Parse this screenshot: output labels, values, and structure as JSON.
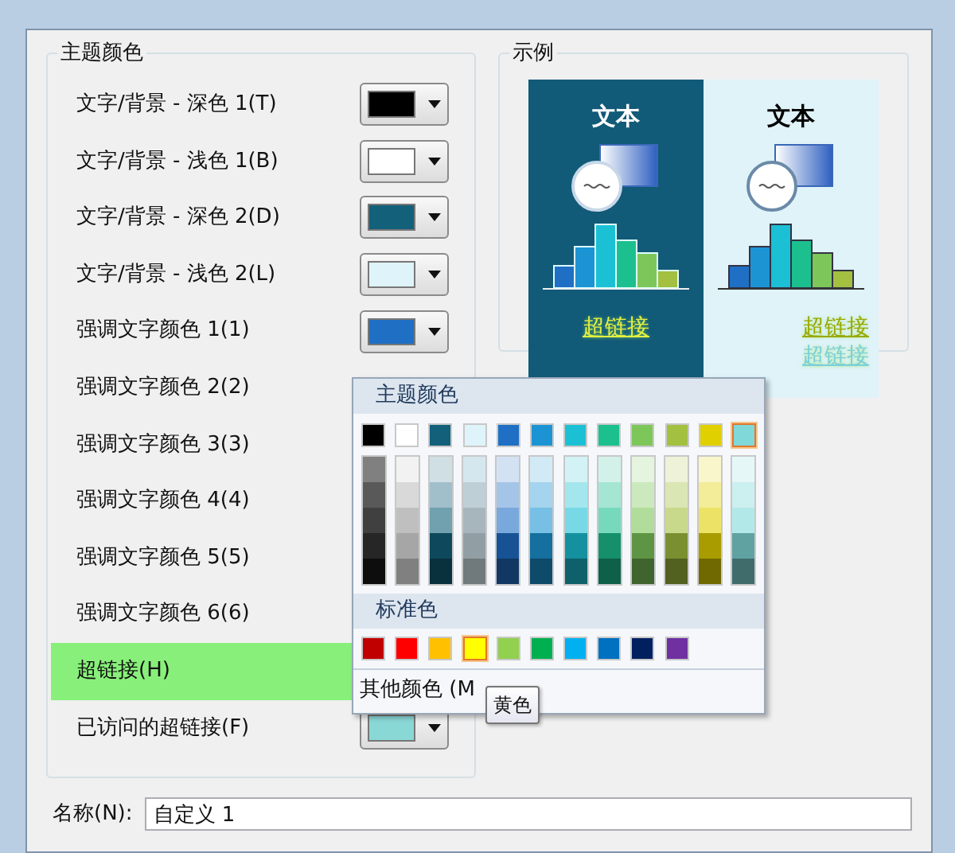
{
  "theme_colors": {
    "title": "主题颜色",
    "items": [
      {
        "label": "文字/背景 - 深色 1(T)",
        "color": "#000000",
        "highlighted": false
      },
      {
        "label": "文字/背景 - 浅色 1(B)",
        "color": "#ffffff",
        "highlighted": false
      },
      {
        "label": "文字/背景 - 深色 2(D)",
        "color": "#12607a",
        "highlighted": false
      },
      {
        "label": "文字/背景 - 浅色 2(L)",
        "color": "#dff3fa",
        "highlighted": false
      },
      {
        "label": "强调文字颜色 1(1)",
        "color": "#1f6fc5",
        "highlighted": false
      },
      {
        "label": "强调文字颜色 2(2)",
        "highlighted": false
      },
      {
        "label": "强调文字颜色 3(3)",
        "highlighted": false
      },
      {
        "label": "强调文字颜色 4(4)",
        "highlighted": false
      },
      {
        "label": "强调文字颜色 5(5)",
        "highlighted": false
      },
      {
        "label": "强调文字颜色 6(6)",
        "highlighted": false
      },
      {
        "label": "超链接(H)",
        "highlighted": true
      },
      {
        "label": "已访问的超链接(F)",
        "color": "#8ad8d6",
        "highlighted": false
      }
    ]
  },
  "sample": {
    "title": "示例",
    "panels": [
      {
        "kind": "dark",
        "color": "#115a78",
        "heading": "文本",
        "links": [
          {
            "text": "超链接",
            "color": "#e4f040"
          }
        ]
      },
      {
        "kind": "light",
        "color": "#dff3f9",
        "heading": "文本",
        "links": [
          {
            "text": "超链接",
            "color": "#9aa800"
          },
          {
            "text": "超链接",
            "color": "#7ccfd8"
          }
        ]
      }
    ]
  },
  "color_menu": {
    "theme_title": "主题颜色",
    "theme_swatches": [
      {
        "color": "#000000",
        "selected": false
      },
      {
        "color": "#ffffff",
        "selected": false
      },
      {
        "color": "#12607a",
        "selected": false
      },
      {
        "color": "#dff3fa",
        "selected": false
      },
      {
        "color": "#1f6fc5",
        "selected": false
      },
      {
        "color": "#1c94d4",
        "selected": false
      },
      {
        "color": "#1cc0d4",
        "selected": false
      },
      {
        "color": "#1cc08f",
        "selected": false
      },
      {
        "color": "#7dc75a",
        "selected": false
      },
      {
        "color": "#a3c040",
        "selected": false
      },
      {
        "color": "#e0d000",
        "selected": false
      },
      {
        "color": "#80d8d8",
        "selected": true
      }
    ],
    "standard_title": "标准色",
    "standard_swatches": [
      {
        "color": "#c00000",
        "hovered": false
      },
      {
        "color": "#ff0000",
        "hovered": false
      },
      {
        "color": "#ffc000",
        "hovered": false
      },
      {
        "color": "#ffff00",
        "hovered": true
      },
      {
        "color": "#92d050",
        "hovered": false
      },
      {
        "color": "#00b050",
        "hovered": false
      },
      {
        "color": "#00b0f0",
        "hovered": false
      },
      {
        "color": "#0070c0",
        "hovered": false
      },
      {
        "color": "#002060",
        "hovered": false
      },
      {
        "color": "#7030a0",
        "hovered": false
      }
    ],
    "more_colors": "其他颜色 (M"
  },
  "tooltip": "黄色",
  "name_field": {
    "label": "名称(N):",
    "value": "自定义 1"
  }
}
